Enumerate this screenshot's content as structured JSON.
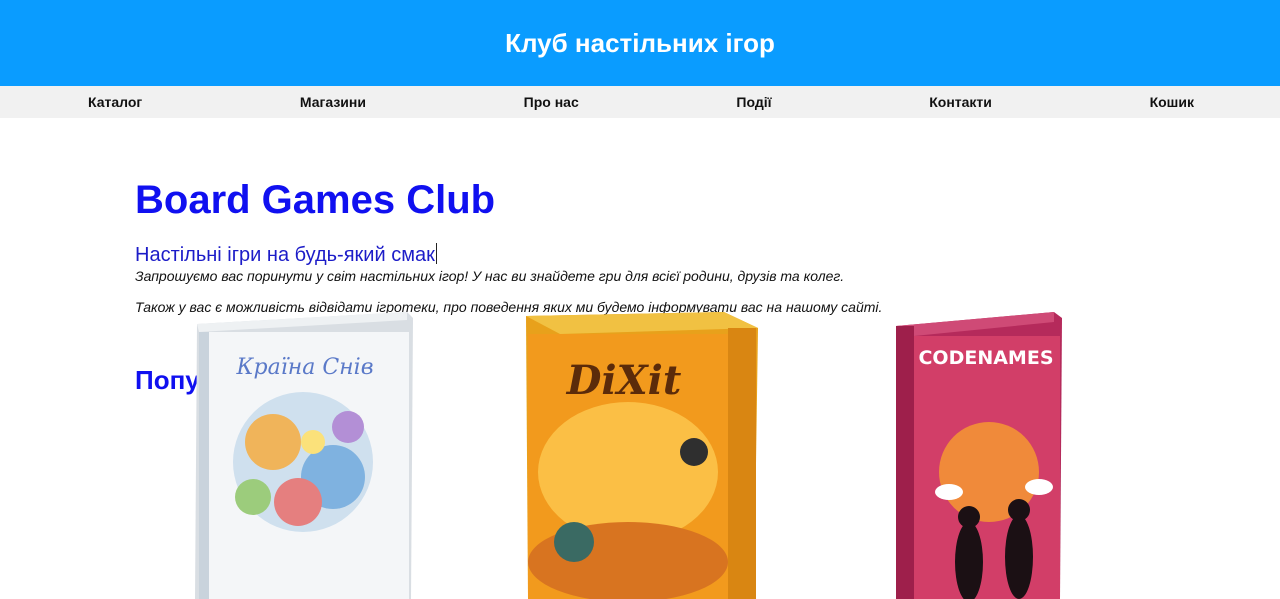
{
  "header": {
    "title": "Клуб настільних ігор"
  },
  "nav": [
    {
      "label": "Каталог"
    },
    {
      "label": "Магазини"
    },
    {
      "label": "Про нас"
    },
    {
      "label": "Події"
    },
    {
      "label": "Контакти"
    },
    {
      "label": "Кошик"
    }
  ],
  "main": {
    "title": "Board Games Club",
    "subtitle": "Настільні ігри на будь-який смак",
    "paragraph1": "Запрошуємо вас поринути у світ настільних ігор! У нас ви знайдете гри для всієї родини, друзів та колег.",
    "paragraph2": "Також у вас є можливість відвідати ігротеки, про поведення яких ми будемо інформувати вас на нашому сайті.",
    "popular_heading": "Популярні ігри"
  },
  "games": [
    {
      "box_title": "Країна Снів"
    },
    {
      "box_title": "DiXit"
    },
    {
      "box_title": "CODENAMES"
    }
  ],
  "colors": {
    "header_bg": "#0a9cff",
    "nav_bg": "#f1f1f1",
    "heading_blue": "#1010f0"
  }
}
